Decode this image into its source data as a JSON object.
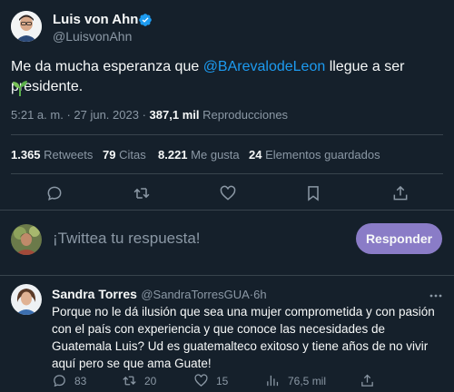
{
  "tweet": {
    "author_name": "Luis von Ahn",
    "author_handle": "@LuisvonAhn",
    "text_before": "Me da mucha esperanza que ",
    "mention": "@BArevalodeLeon",
    "text_after": " llegue a ser presidente.",
    "emoji": "🌱",
    "time": "5:21 a. m.",
    "date": "27 jun. 2023",
    "views_count": "387,1 mil",
    "views_label": "Reproducciones"
  },
  "stats": {
    "retweets_count": "1.365",
    "retweets_label": "Retweets",
    "quotes_count": "79",
    "quotes_label": "Citas",
    "likes_count": "8.221",
    "likes_label": "Me gusta",
    "bookmarks_count": "24",
    "bookmarks_label": "Elementos guardados"
  },
  "compose": {
    "placeholder": "¡Twittea tu respuesta!",
    "button_label": "Responder"
  },
  "reply": {
    "author_name": "Sandra Torres",
    "author_handle": "@SandraTorresGUA",
    "separator": "·",
    "time": "6h",
    "text": "Porque no le dá ilusión que sea una mujer comprometida y con pasión con el  país con experiencia y que conoce las necesidades de Guatemala Luis? Ud es guatemalteco exitoso y tiene años de no vivir aquí pero se que ama Guate!",
    "replies": "83",
    "retweets": "20",
    "likes": "15",
    "views": "76,5 mil"
  },
  "colors": {
    "background": "#15202b",
    "accent": "#1d9bf0",
    "reply_button": "#8a7cc7",
    "verified_badge": "#1d9bf0"
  }
}
